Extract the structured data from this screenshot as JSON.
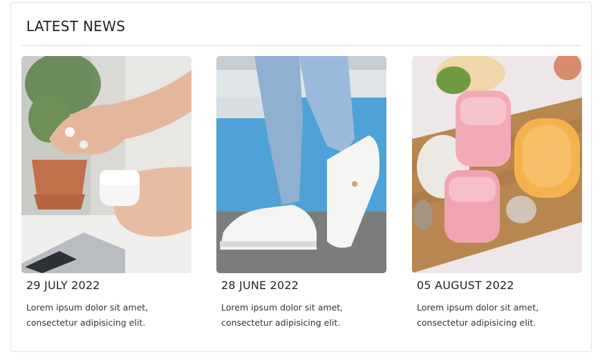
{
  "section": {
    "title": "LATEST NEWS"
  },
  "news": [
    {
      "date": "29 JULY 2022",
      "text": "Lorem ipsum dolor sit amet, consectetur adipisicing elit.",
      "image": "earbuds-photo"
    },
    {
      "date": "28 JUNE 2022",
      "text": "Lorem ipsum dolor sit amet, consectetur adipisicing elit.",
      "image": "sneakers-photo"
    },
    {
      "date": "05 AUGUST 2022",
      "text": "Lorem ipsum dolor sit amet, consectetur adipisicing elit.",
      "image": "cosmetics-photo"
    }
  ]
}
